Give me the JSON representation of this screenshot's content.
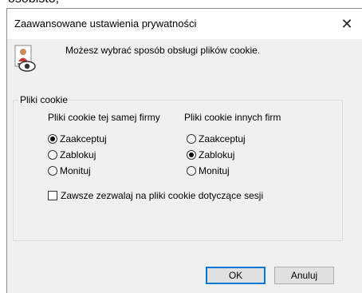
{
  "background_fragment": "osobisto,",
  "dialog": {
    "title": "Zaawansowane ustawienia prywatności",
    "close_glyph": "✕",
    "info_text": "Możesz wybrać sposób obsługi plików cookie.",
    "group": {
      "legend": "Pliki cookie",
      "first_party": {
        "header": "Pliki cookie tej samej firmy",
        "options": [
          "Zaakceptuj",
          "Zablokuj",
          "Monituj"
        ],
        "selected": "Zaakceptuj"
      },
      "third_party": {
        "header": "Pliki cookie innych firm",
        "options": [
          "Zaakceptuj",
          "Zablokuj",
          "Monituj"
        ],
        "selected": "Zablokuj"
      },
      "session_checkbox": {
        "label": "Zawsze zezwalaj na pliki cookie dotyczące sesji",
        "checked": false
      }
    },
    "buttons": {
      "ok": "OK",
      "cancel": "Anuluj"
    },
    "colors": {
      "window_bg": "#f0f0f0",
      "titlebar_bg": "#ffffff",
      "focus_border": "#0078d7"
    }
  }
}
